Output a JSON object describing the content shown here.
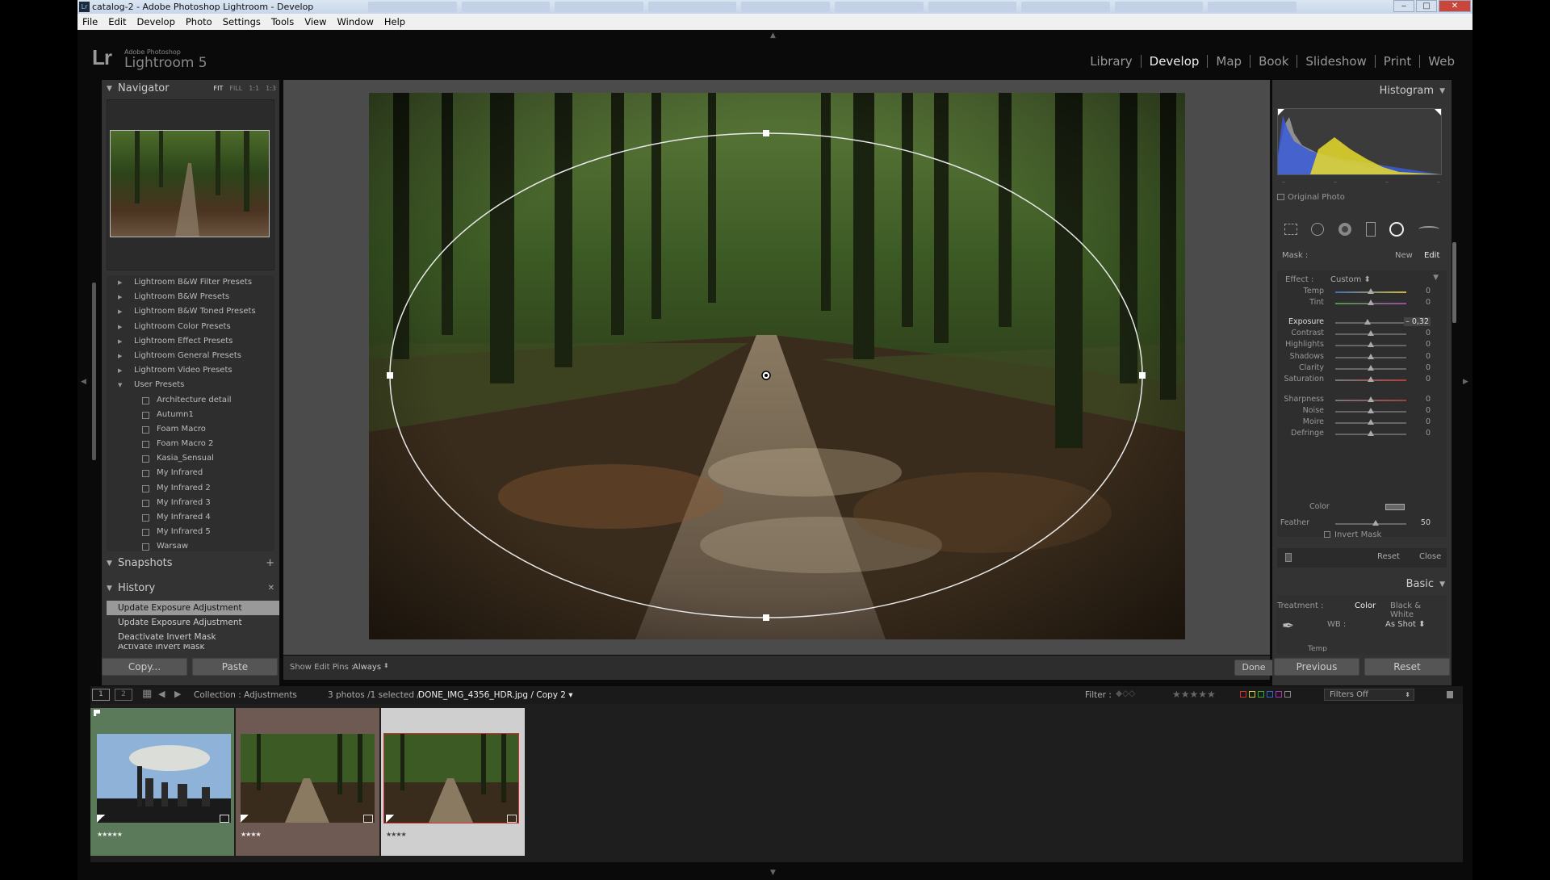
{
  "window": {
    "title": "catalog-2 - Adobe Photoshop Lightroom - Develop",
    "app_icon": "Lr",
    "minimize": "‒",
    "maximize": "□",
    "close": "✕"
  },
  "menu": [
    "File",
    "Edit",
    "Develop",
    "Photo",
    "Settings",
    "Tools",
    "View",
    "Window",
    "Help"
  ],
  "identity": {
    "logo": "Lr",
    "vendor": "Adobe Photoshop",
    "product": "Lightroom 5"
  },
  "modules": [
    "Library",
    "Develop",
    "Map",
    "Book",
    "Slideshow",
    "Print",
    "Web"
  ],
  "active_module": "Develop",
  "navigator": {
    "title": "Navigator",
    "options": [
      "FIT",
      "FILL",
      "1:1",
      "1:3"
    ],
    "selected_option": "FIT"
  },
  "presets": {
    "folders": [
      "Lightroom B&W Filter Presets",
      "Lightroom B&W Presets",
      "Lightroom B&W Toned Presets",
      "Lightroom Color Presets",
      "Lightroom Effect Presets",
      "Lightroom General Presets",
      "Lightroom Video Presets",
      "User Presets"
    ],
    "user_items": [
      "Architecture detail",
      "Autumn1",
      "Foam Macro",
      "Foam Macro 2",
      "Kasia_Sensual",
      "My Infrared",
      "My Infrared 2",
      "My Infrared 3",
      "My Infrared 4",
      "My Infrared 5",
      "Warsaw"
    ]
  },
  "snapshots": {
    "title": "Snapshots",
    "add": "+"
  },
  "history": {
    "title": "History",
    "clear": "✕",
    "items": [
      "Update Exposure Adjustment",
      "Update Exposure Adjustment",
      "Deactivate Invert Mask",
      "Activate Invert Mask"
    ]
  },
  "left_buttons": {
    "copy": "Copy...",
    "paste": "Paste"
  },
  "toolbar": {
    "show_edit_pins_label": "Show Edit Pins :",
    "show_edit_pins_value": "Always",
    "done": "Done"
  },
  "histogram": {
    "title": "Histogram",
    "original_photo": "Original Photo"
  },
  "mask": {
    "label": "Mask :",
    "new": "New",
    "edit": "Edit",
    "effect_label": "Effect :",
    "effect_value": "Custom",
    "sliders": [
      {
        "label": "Temp",
        "value": "0",
        "pos": 0.5
      },
      {
        "label": "Tint",
        "value": "0",
        "pos": 0.5
      },
      {
        "label": "Exposure",
        "value": "– 0,32",
        "pos": 0.46
      },
      {
        "label": "Contrast",
        "value": "0",
        "pos": 0.5
      },
      {
        "label": "Highlights",
        "value": "0",
        "pos": 0.5
      },
      {
        "label": "Shadows",
        "value": "0",
        "pos": 0.5
      },
      {
        "label": "Clarity",
        "value": "0",
        "pos": 0.5
      },
      {
        "label": "Saturation",
        "value": "0",
        "pos": 0.5
      },
      {
        "label": "Sharpness",
        "value": "0",
        "pos": 0.5
      },
      {
        "label": "Noise",
        "value": "0",
        "pos": 0.5
      },
      {
        "label": "Moire",
        "value": "0",
        "pos": 0.5
      },
      {
        "label": "Defringe",
        "value": "0",
        "pos": 0.5
      }
    ],
    "color_label": "Color",
    "feather_label": "Feather",
    "feather_value": "50",
    "invert_mask": "Invert Mask",
    "reset": "Reset",
    "close": "Close"
  },
  "basic": {
    "title": "Basic",
    "treatment_label": "Treatment :",
    "color": "Color",
    "bw": "Black & White",
    "wb_label": "WB :",
    "wb_value": "As Shot",
    "temp": "Temp"
  },
  "right_buttons": {
    "previous": "Previous",
    "reset": "Reset"
  },
  "filmstrip": {
    "view1": "1",
    "view2": "2",
    "collection": "Collection : Adjustments",
    "count": "3 photos /1 selected /",
    "filename": "DONE_IMG_4356_HDR.jpg / Copy 2",
    "filter_label": "Filter :",
    "filters_off": "Filters Off",
    "thumbs": [
      {
        "stars": "★★★★★",
        "rating": 5,
        "bg": "#5a7a5a"
      },
      {
        "stars": "★★★★",
        "rating": 4,
        "bg": "#6e5a52"
      },
      {
        "stars": "★★★★",
        "rating": 4,
        "bg": "#cfcfcf"
      }
    ]
  }
}
